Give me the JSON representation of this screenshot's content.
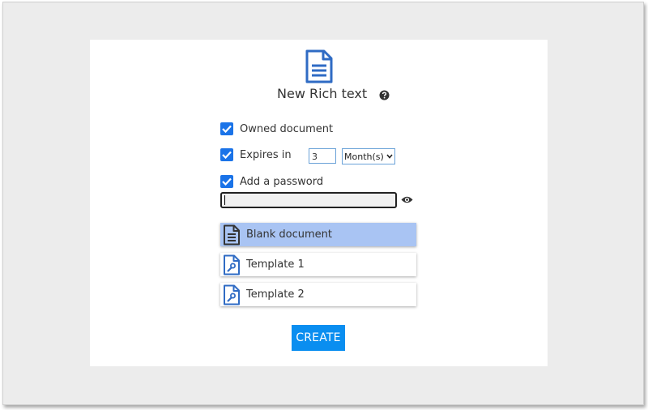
{
  "dialog": {
    "title": "New Rich text",
    "options": {
      "owned": {
        "label": "Owned document",
        "checked": true
      },
      "expires": {
        "label": "Expires in",
        "checked": true,
        "value": "3",
        "unit": "Month(s)"
      },
      "password": {
        "label": "Add a password",
        "checked": true,
        "value": ""
      }
    },
    "templates": [
      {
        "label": "Blank document",
        "icon": "document-lines-icon",
        "selected": true
      },
      {
        "label": "Template 1",
        "icon": "document-wrench-icon",
        "selected": false
      },
      {
        "label": "Template 2",
        "icon": "document-wrench-icon",
        "selected": false
      }
    ],
    "create_label": "CREATE"
  },
  "colors": {
    "accent": "#0a8ef0",
    "checkbox": "#1a73e8",
    "selected": "#a9c4f3",
    "icon": "#2f6bc4"
  }
}
